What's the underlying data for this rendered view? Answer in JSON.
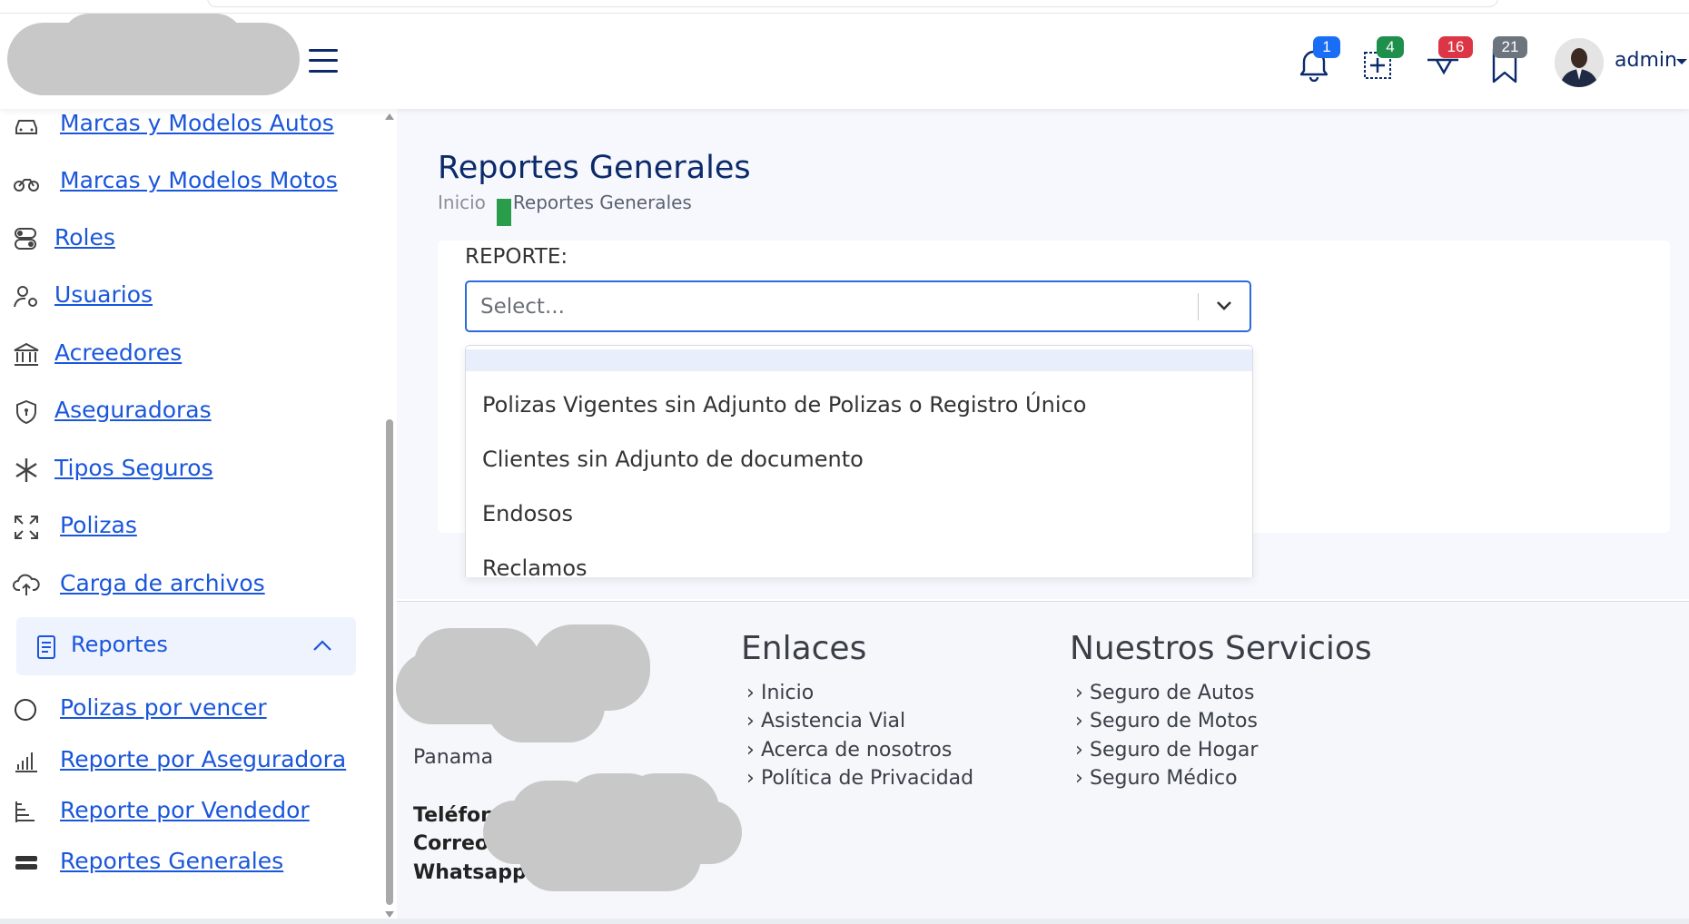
{
  "header": {
    "notifications": [
      {
        "icon": "bell-icon",
        "count": "1",
        "color": "#1a6ef5"
      },
      {
        "icon": "add-square-icon",
        "count": "4",
        "color": "#1f8f4c"
      },
      {
        "icon": "check-bubble-icon",
        "count": "16",
        "color": "#dc3545"
      },
      {
        "icon": "bookmark-icon",
        "count": "21",
        "color": "#6c757d"
      }
    ],
    "user": {
      "name": "admin"
    }
  },
  "sidebar": {
    "items": [
      {
        "label": "Marcas y Modelos Autos",
        "icon": "car-icon"
      },
      {
        "label": "Marcas y Modelos Motos",
        "icon": "motorcycle-icon"
      },
      {
        "label": "Roles",
        "icon": "toggle-icon"
      },
      {
        "label": "Usuarios",
        "icon": "user-gear-icon"
      },
      {
        "label": "Acreedores",
        "icon": "bank-icon"
      },
      {
        "label": "Aseguradoras",
        "icon": "shield-icon"
      },
      {
        "label": "Tipos Seguros",
        "icon": "asterisk-icon"
      },
      {
        "label": "Polizas",
        "icon": "expand-icon"
      },
      {
        "label": "Carga de archivos",
        "icon": "cloud-upload-icon"
      }
    ],
    "group": {
      "label": "Reportes",
      "icon": "report-doc-icon"
    },
    "sub_items": [
      {
        "label": "Polizas por vencer",
        "icon": "circle-icon"
      },
      {
        "label": "Reporte por Aseguradora",
        "icon": "bar-chart-icon"
      },
      {
        "label": "Reporte por Vendedor",
        "icon": "tree-list-icon"
      },
      {
        "label": "Reportes Generales",
        "icon": "ticket-icon"
      }
    ]
  },
  "main": {
    "title": "Reportes Generales",
    "breadcrumb": {
      "home": "Inicio",
      "separator": "/",
      "current": "Reportes Generales"
    },
    "report_label": "REPORTE:",
    "select": {
      "placeholder": "Select..."
    },
    "options": [
      "Polizas Vigentes sin Adjunto de Polizas o Registro Único",
      "Clientes sin Adjunto de documento",
      "Endosos",
      "Reclamos"
    ]
  },
  "footer": {
    "city": "Panama",
    "contacts": [
      "Teléfon",
      "Correo:",
      "Whatsapp:"
    ],
    "links_title": "Enlaces",
    "links": [
      "Inicio",
      "Asistencia Vial",
      "Acerca de nosotros",
      "Política de Privacidad"
    ],
    "services_title": "Nuestros Servicios",
    "services": [
      "Seguro de Autos",
      "Seguro de Motos",
      "Seguro de Hogar",
      "Seguro Médico"
    ]
  }
}
